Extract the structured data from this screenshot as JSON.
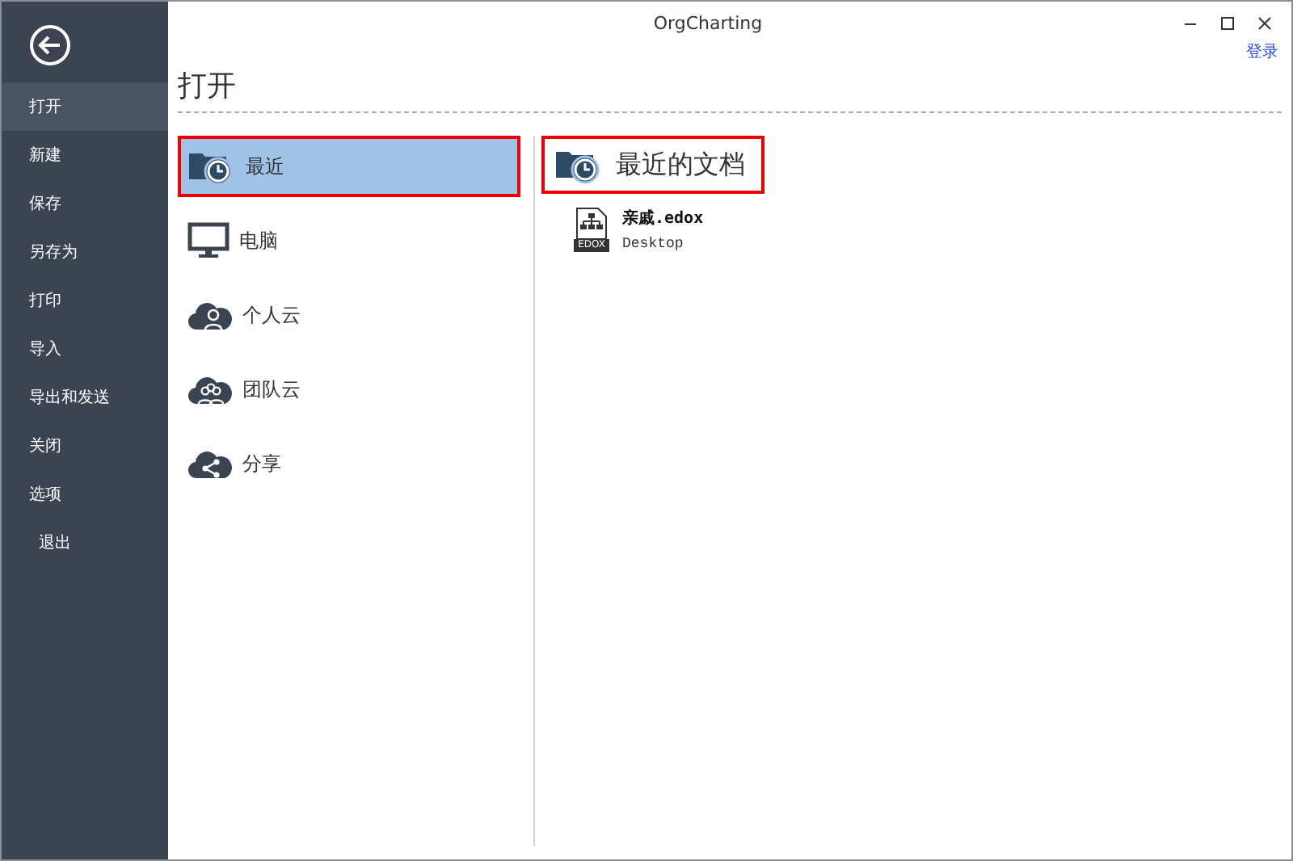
{
  "window": {
    "title": "OrgCharting"
  },
  "login_link": "登录",
  "sidebar": {
    "items": [
      {
        "label": "打开",
        "selected": true,
        "kind": "menu"
      },
      {
        "label": "新建",
        "selected": false,
        "kind": "menu"
      },
      {
        "label": "保存",
        "selected": false,
        "kind": "menu"
      },
      {
        "label": "另存为",
        "selected": false,
        "kind": "menu"
      },
      {
        "label": "打印",
        "selected": false,
        "kind": "menu"
      },
      {
        "label": "导入",
        "selected": false,
        "kind": "menu"
      },
      {
        "label": "导出和发送",
        "selected": false,
        "kind": "menu"
      },
      {
        "label": "关闭",
        "selected": false,
        "kind": "menu"
      },
      {
        "label": "选项",
        "selected": false,
        "kind": "menu"
      },
      {
        "label": "退出",
        "selected": false,
        "kind": "exit"
      }
    ]
  },
  "page_title": "打开",
  "locations": [
    {
      "label": "最近",
      "kind": "recent",
      "selected": true
    },
    {
      "label": "电脑",
      "kind": "computer",
      "selected": false
    },
    {
      "label": "个人云",
      "kind": "personal-cloud",
      "selected": false
    },
    {
      "label": "团队云",
      "kind": "team-cloud",
      "selected": false
    },
    {
      "label": "分享",
      "kind": "share",
      "selected": false
    }
  ],
  "recent": {
    "title": "最近的文档",
    "highlighted": true,
    "files": [
      {
        "name": "亲戚.edox",
        "location": "Desktop",
        "icon_label": "EDOX"
      }
    ]
  }
}
